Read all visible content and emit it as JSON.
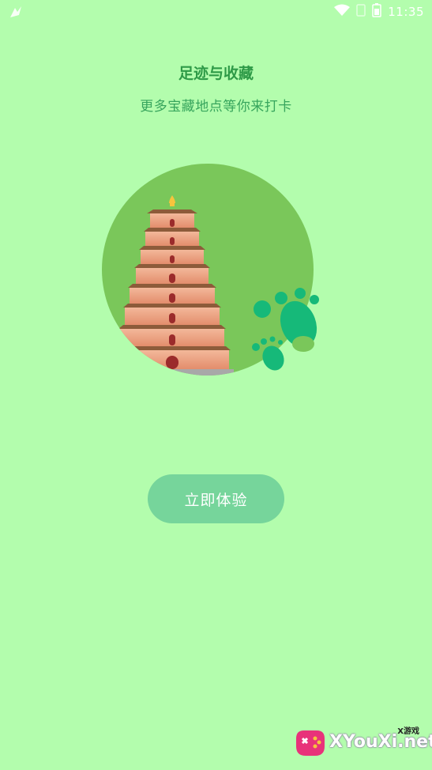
{
  "status_bar": {
    "time": "11:35",
    "icons": [
      "app-notification-icon",
      "wifi-icon",
      "sim-icon",
      "battery-icon"
    ]
  },
  "onboarding": {
    "title": "足迹与收藏",
    "subtitle": "更多宝藏地点等你来打卡",
    "illustration": "pagoda-footprints-illustration"
  },
  "cta": {
    "label": "立即体验"
  },
  "watermark": {
    "brand": "XYouXi.net",
    "small": "X游戏"
  },
  "colors": {
    "background": "#b3fdad",
    "title": "#2e9a47",
    "button": "#76d59b",
    "circle": "#7ac75a",
    "footprint": "#16b979"
  }
}
